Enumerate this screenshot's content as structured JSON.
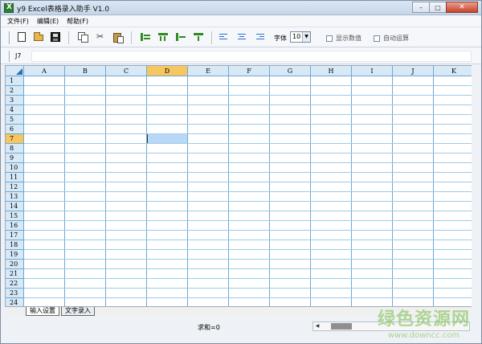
{
  "window": {
    "title": "y9 Excel表格录入助手  V1.0",
    "minimize_glyph": "–",
    "maximize_glyph": "□",
    "close_glyph": "✕"
  },
  "menu": {
    "items": [
      "文件(F)",
      "编辑(E)",
      "帮助(F)"
    ]
  },
  "toolbar": {
    "font_label": "字体",
    "font_size": "10",
    "show_values_label": "显示数值",
    "auto_calc_label": "自动运算",
    "show_values_checked": false,
    "auto_calc_checked": false,
    "icons": [
      "new-file-icon",
      "open-folder-icon",
      "save-icon",
      "copy-icon",
      "cut-icon",
      "paste-icon",
      "insert-row-icon",
      "insert-col-icon",
      "delete-row-icon",
      "delete-col-icon",
      "align-left-icon",
      "align-center-icon",
      "align-right-icon"
    ]
  },
  "formula": {
    "cell_ref": "J7",
    "value": ""
  },
  "grid": {
    "columns": [
      "A",
      "B",
      "C",
      "D",
      "E",
      "F",
      "G",
      "H",
      "I",
      "J",
      "K"
    ],
    "rows": [
      "1",
      "2",
      "3",
      "4",
      "5",
      "6",
      "7",
      "8",
      "9",
      "10",
      "11",
      "12",
      "13",
      "14",
      "15",
      "16",
      "17",
      "18",
      "19",
      "20",
      "21",
      "22",
      "23",
      "24"
    ],
    "active_column": "D",
    "active_row": "7",
    "header_color": "#d7e9f7",
    "active_header_color": "#f6c660",
    "selection_color": "#b8d8f5"
  },
  "tabs": [
    "输入设置",
    "文字录入"
  ],
  "status": {
    "sum_text": "求和=0"
  },
  "watermark": {
    "text": "绿色资源网",
    "url": "www.downcc.com"
  }
}
